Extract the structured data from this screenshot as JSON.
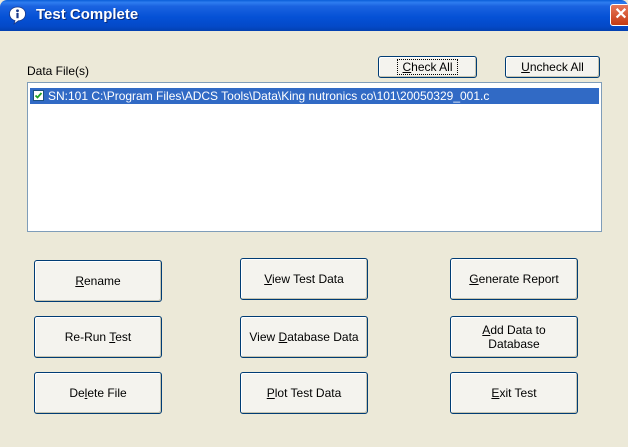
{
  "window": {
    "title": "Test Complete",
    "close_glyph": "✕"
  },
  "data_files": {
    "label": "Data File(s)",
    "check_all": {
      "pre": "",
      "ul": "C",
      "post": "heck All"
    },
    "uncheck_all": {
      "pre": "",
      "ul": "U",
      "post": "ncheck All"
    },
    "items": [
      {
        "checked": true,
        "text": "SN:101 C:\\Program Files\\ADCS Tools\\Data\\King nutronics co\\101\\20050329_001.c"
      }
    ]
  },
  "buttons": {
    "rename": {
      "pre": "",
      "ul": "R",
      "post": "ename"
    },
    "view_test_data": {
      "pre": "",
      "ul": "V",
      "post": "iew Test Data"
    },
    "generate_report": {
      "pre": "",
      "ul": "G",
      "post": "enerate Report"
    },
    "rerun_test": {
      "pre": "Re-Run ",
      "ul": "T",
      "post": "est"
    },
    "view_database_data": {
      "pre": "View ",
      "ul": "D",
      "post": "atabase Data"
    },
    "add_data_to_database": {
      "pre": "",
      "ul": "A",
      "post": "dd Data to",
      "line2": "Database"
    },
    "delete_file": {
      "pre": "De",
      "ul": "l",
      "post": "ete File"
    },
    "plot_test_data": {
      "pre": "",
      "ul": "P",
      "post": "lot Test Data"
    },
    "exit_test": {
      "pre": "",
      "ul": "E",
      "post": "xit Test"
    }
  },
  "colors": {
    "titlebar": "#0551d6",
    "selection": "#316ac5",
    "face": "#ece9d8"
  }
}
